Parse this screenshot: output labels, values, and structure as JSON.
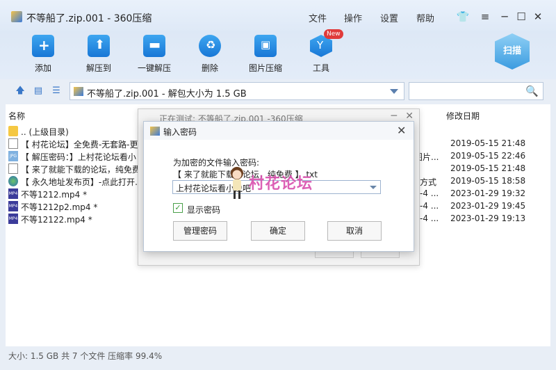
{
  "window": {
    "title": "不等船了.zip.001 - 360压缩",
    "menu": [
      "文件",
      "操作",
      "设置",
      "帮助"
    ]
  },
  "toolbar": {
    "items": [
      {
        "label": "添加",
        "icon": "add-icon"
      },
      {
        "label": "解压到",
        "icon": "extract-to-icon"
      },
      {
        "label": "一键解压",
        "icon": "one-click-extract-icon"
      },
      {
        "label": "删除",
        "icon": "delete-icon"
      },
      {
        "label": "图片压缩",
        "icon": "image-compress-icon"
      },
      {
        "label": "工具",
        "icon": "tools-icon"
      }
    ],
    "new_badge": "New",
    "scan_label": "扫描"
  },
  "address": {
    "path": "不等船了.zip.001 - 解包大小为 1.5 GB"
  },
  "columns": {
    "name": "名称",
    "date": "修改日期"
  },
  "files": [
    {
      "name": ".. (上级目录)",
      "type": "",
      "date": "",
      "icon": "folder-icon"
    },
    {
      "name": "【 村花论坛】全免费-无套路-更",
      "type": "",
      "date": "2019-05-15 21:48",
      "icon": "text-file-icon"
    },
    {
      "name": "【 解压密码：】上村花论坛看小",
      "type": "图片...",
      "date": "2019-05-15 22:46",
      "icon": "jpg-file-icon"
    },
    {
      "name": "【 来了就能下载的论坛，纯免费",
      "type": "",
      "date": "2019-05-15 21:48",
      "icon": "text-file-icon"
    },
    {
      "name": "【 永久地址发布页】-点此打开.",
      "type": "方式",
      "date": "2019-05-15 18:58",
      "icon": "web-link-icon"
    },
    {
      "name": "不等1212.mp4 *",
      "type": "-4 ...",
      "date": "2023-01-29 19:32",
      "icon": "mp4-file-icon"
    },
    {
      "name": "不等1212p2.mp4 *",
      "type": "-4 ...",
      "date": "2023-01-29 19:45",
      "icon": "mp4-file-icon"
    },
    {
      "name": "不等12122.mp4 *",
      "type": "-4 ...",
      "date": "2023-01-29 19:13",
      "icon": "mp4-file-icon"
    }
  ],
  "status": "大小: 1.5 GB 共 7 个文件 压缩率 99.4%",
  "test_dialog": {
    "title": "正在测试: 不等船了.zip.001 -360压缩"
  },
  "password_dialog": {
    "title": "输入密码",
    "prompt": "为加密的文件输入密码:",
    "filename": "【 来了就能下载的论坛，纯免费 】.txt",
    "password_value": "上村花论坛看小说吧",
    "show_password_label": "显示密码",
    "show_password_checked": true,
    "buttons": {
      "manage": "管理密码",
      "ok": "确定",
      "cancel": "取消"
    }
  },
  "watermark": "村花论坛"
}
